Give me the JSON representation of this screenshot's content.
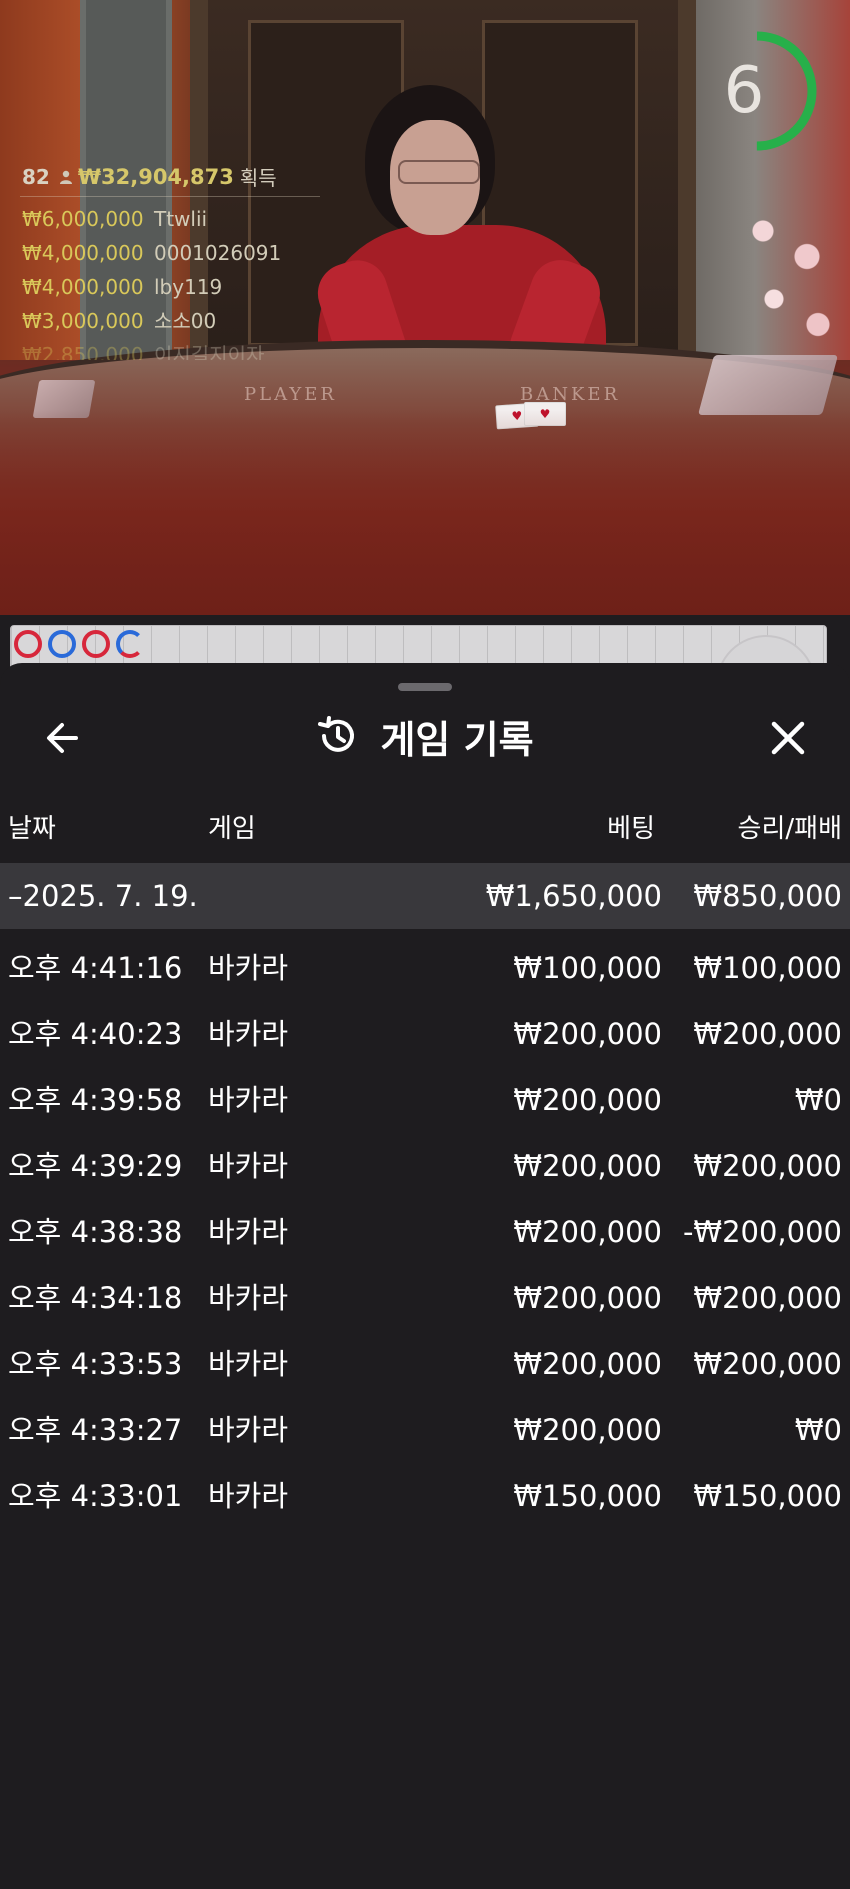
{
  "timer": {
    "value": "6",
    "progress": 0.5,
    "color": "#27b04a"
  },
  "winners": {
    "count": "82",
    "total": "₩32,904,873",
    "gain_label": "획득",
    "list": [
      {
        "amount": "₩6,000,000",
        "name": "Ttwlii"
      },
      {
        "amount": "₩4,000,000",
        "name": "0001026091"
      },
      {
        "amount": "₩4,000,000",
        "name": "lby119"
      },
      {
        "amount": "₩3,000,000",
        "name": "소소00"
      },
      {
        "amount": "₩2,850,000",
        "name": "이지길지이자"
      }
    ]
  },
  "table": {
    "player_label": "PLAYER",
    "banker_label": "BANKER"
  },
  "roadmap": {
    "beads": [
      "red",
      "blue",
      "red",
      "half"
    ]
  },
  "sheet": {
    "title": "게임 기록",
    "columns": {
      "date": "날짜",
      "game": "게임",
      "bet": "베팅",
      "winloss": "승리/패배"
    },
    "summary": {
      "date": "–2025. 7. 19.",
      "bet": "₩1,650,000",
      "winloss": "₩850,000"
    },
    "rows": [
      {
        "time": "오후 4:41:16",
        "game": "바카라",
        "bet": "₩100,000",
        "winloss": "₩100,000"
      },
      {
        "time": "오후 4:40:23",
        "game": "바카라",
        "bet": "₩200,000",
        "winloss": "₩200,000"
      },
      {
        "time": "오후 4:39:58",
        "game": "바카라",
        "bet": "₩200,000",
        "winloss": "₩0"
      },
      {
        "time": "오후 4:39:29",
        "game": "바카라",
        "bet": "₩200,000",
        "winloss": "₩200,000"
      },
      {
        "time": "오후 4:38:38",
        "game": "바카라",
        "bet": "₩200,000",
        "winloss": "-₩200,000"
      },
      {
        "time": "오후 4:34:18",
        "game": "바카라",
        "bet": "₩200,000",
        "winloss": "₩200,000"
      },
      {
        "time": "오후 4:33:53",
        "game": "바카라",
        "bet": "₩200,000",
        "winloss": "₩200,000"
      },
      {
        "time": "오후 4:33:27",
        "game": "바카라",
        "bet": "₩200,000",
        "winloss": "₩0"
      },
      {
        "time": "오후 4:33:01",
        "game": "바카라",
        "bet": "₩150,000",
        "winloss": "₩150,000"
      }
    ]
  },
  "icons": {
    "back": "arrow-left-icon",
    "history": "history-clock-icon",
    "close": "close-icon"
  }
}
